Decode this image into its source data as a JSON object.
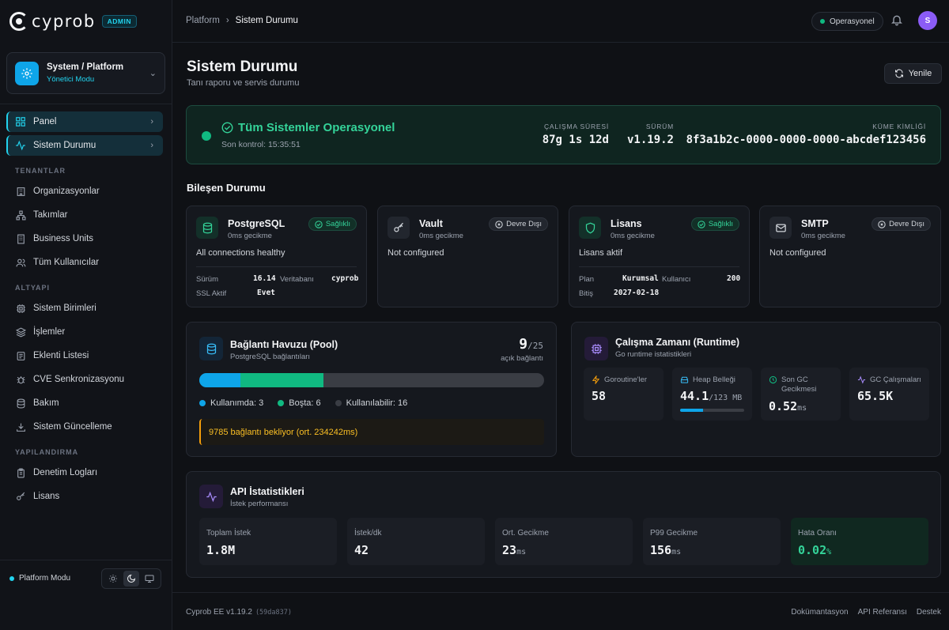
{
  "brand": {
    "name": "cyprob",
    "badge": "ADMIN"
  },
  "workspace": {
    "title": "System / Platform",
    "subtitle": "Yönetici Modu"
  },
  "nav": {
    "top": [
      {
        "label": "Panel"
      },
      {
        "label": "Sistem Durumu"
      }
    ],
    "sections": [
      {
        "title": "TENANTLAR",
        "items": [
          "Organizasyonlar",
          "Takımlar",
          "Business Units",
          "Tüm Kullanıcılar"
        ]
      },
      {
        "title": "ALTYAPI",
        "items": [
          "Sistem Birimleri",
          "İşlemler",
          "Eklenti Listesi",
          "CVE Senkronizasyonu",
          "Bakım",
          "Sistem Güncelleme"
        ]
      },
      {
        "title": "YAPILANDIRMA",
        "items": [
          "Denetim Logları",
          "Lisans"
        ]
      }
    ]
  },
  "sidebar_footer": {
    "mode": "Platform Modu"
  },
  "header": {
    "breadcrumb": [
      "Platform",
      "Sistem Durumu"
    ],
    "status": "Operasyonel",
    "avatar": "S"
  },
  "page": {
    "title": "Sistem Durumu",
    "subtitle": "Tanı raporu ve servis durumu",
    "refresh": "Yenile"
  },
  "banner": {
    "title": "Tüm Sistemler Operasyonel",
    "last_check": "Son kontrol: 15:35:51",
    "uptime_label": "ÇALIŞMA SÜRESİ",
    "uptime": "87g 1s 12d",
    "version_label": "SÜRÜM",
    "version": "v1.19.2",
    "cluster_label": "KÜME KİMLİĞİ",
    "cluster_id": "8f3a1b2c-0000-0000-0000-abcdef123456"
  },
  "components_title": "Bileşen Durumu",
  "components": [
    {
      "name": "PostgreSQL",
      "latency": "0ms gecikme",
      "status": "Sağlıklı",
      "desc": "All connections healthy",
      "kv": [
        [
          "Sürüm",
          "16.14"
        ],
        [
          "Veritabanı",
          "cyprob"
        ],
        [
          "SSL Aktif",
          "Evet"
        ]
      ]
    },
    {
      "name": "Vault",
      "latency": "0ms gecikme",
      "status": "Devre Dışı",
      "desc": "Not configured"
    },
    {
      "name": "Lisans",
      "latency": "0ms gecikme",
      "status": "Sağlıklı",
      "desc": "Lisans aktif",
      "kv": [
        [
          "Plan",
          "Kurumsal"
        ],
        [
          "Kullanıcı",
          "200"
        ],
        [
          "Bitiş",
          "2027-02-18"
        ]
      ]
    },
    {
      "name": "SMTP",
      "latency": "0ms gecikme",
      "status": "Devre Dışı",
      "desc": "Not configured"
    }
  ],
  "pool": {
    "title": "Bağlantı Havuzu (Pool)",
    "subtitle": "PostgreSQL bağlantıları",
    "open": "9",
    "max": "/25",
    "open_label": "açık bağlantı",
    "in_use": 3,
    "idle": 6,
    "total": 25,
    "legend_in_use": "Kullanımda: 3",
    "legend_idle": "Boşta: 6",
    "legend_available": "Kullanılabilir: 16",
    "warning": "9785 bağlantı bekliyor (ort. 234242ms)",
    "colors": {
      "in_use": "#0ea5e9",
      "idle": "#10b981",
      "available": "#3a3d44"
    }
  },
  "runtime": {
    "title": "Çalışma Zamanı (Runtime)",
    "subtitle": "Go runtime istatistikleri",
    "tiles": [
      {
        "label": "Goroutine'ler",
        "value": "58",
        "unit": ""
      },
      {
        "label": "Heap Belleği",
        "value": "44.1",
        "unit": "/123 MB",
        "fill": 0.36
      },
      {
        "label": "Son GC Gecikmesi",
        "value": "0.52",
        "unit": "ms"
      },
      {
        "label": "GC Çalışmaları",
        "value": "65.5K",
        "unit": ""
      }
    ]
  },
  "api": {
    "title": "API İstatistikleri",
    "subtitle": "İstek performansı",
    "tiles": [
      {
        "label": "Toplam İstek",
        "value": "1.8M",
        "unit": ""
      },
      {
        "label": "İstek/dk",
        "value": "42",
        "unit": ""
      },
      {
        "label": "Ort. Gecikme",
        "value": "23",
        "unit": "ms"
      },
      {
        "label": "P99 Gecikme",
        "value": "156",
        "unit": "ms"
      },
      {
        "label": "Hata Oranı",
        "value": "0.02",
        "unit": "%"
      }
    ]
  },
  "footer": {
    "version": "Cyprob EE v1.19.2",
    "hash": "(59da837)",
    "links": [
      "Dokümantasyon",
      "API Referansı",
      "Destek"
    ]
  }
}
